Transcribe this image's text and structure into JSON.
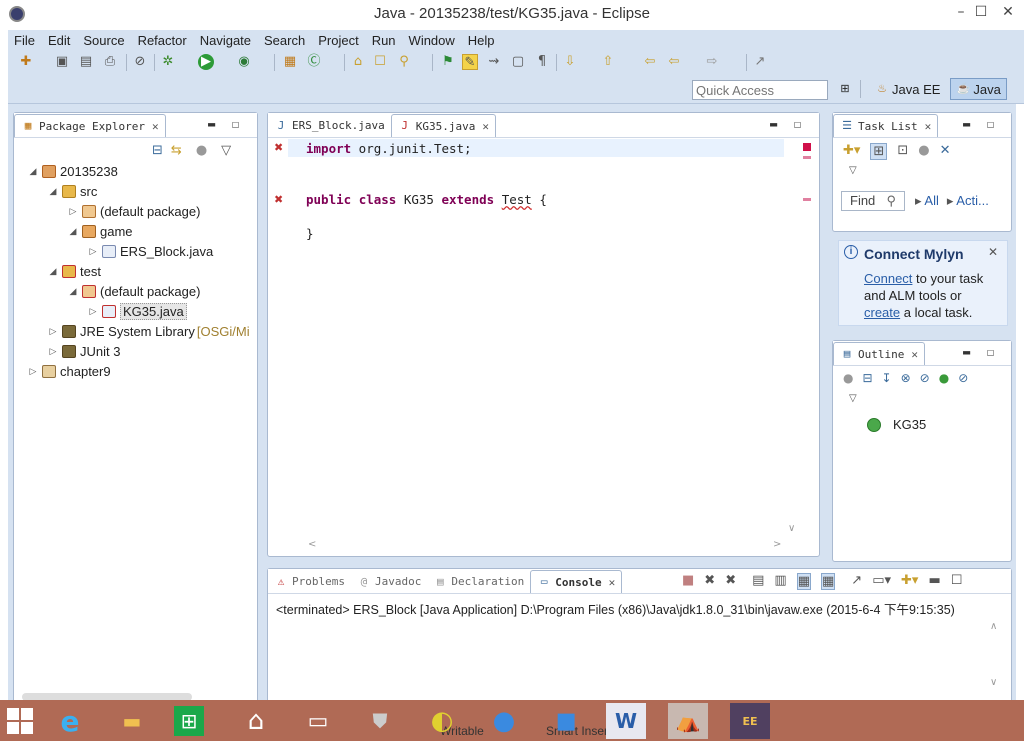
{
  "window": {
    "title": "Java - 20135238/test/KG35.java - Eclipse",
    "min": "–",
    "max": "☐",
    "close": "✕"
  },
  "menu": [
    "File",
    "Edit",
    "Source",
    "Refactor",
    "Navigate",
    "Search",
    "Project",
    "Run",
    "Window",
    "Help"
  ],
  "quick_access": {
    "placeholder": "Quick Access"
  },
  "perspectives": [
    {
      "label": "Java EE"
    },
    {
      "label": "Java",
      "active": true
    }
  ],
  "package_explorer": {
    "title": "Package Explorer",
    "items": [
      {
        "label": "20135238"
      },
      {
        "label": "src"
      },
      {
        "label": "(default package)"
      },
      {
        "label": "game"
      },
      {
        "label": "ERS_Block.java"
      },
      {
        "label": "test"
      },
      {
        "label": "(default package)"
      },
      {
        "label": "KG35.java"
      },
      {
        "label": "JRE System Library",
        "suffix": "[OSGi/Mi"
      },
      {
        "label": "JUnit 3"
      },
      {
        "label": "chapter9"
      }
    ]
  },
  "editor": {
    "tabs": [
      {
        "label": "ERS_Block.java"
      },
      {
        "label": "KG35.java",
        "active": true
      }
    ],
    "lines": {
      "l1_kw": "import",
      "l1_rest": " org.junit.Test;",
      "l3_kw1": "public",
      "l3_kw2": "class",
      "l3_name": " KG35 ",
      "l3_kw3": "extends",
      "l3_type": "Test",
      "l3_end": " {",
      "l5": "}"
    }
  },
  "task_list": {
    "title": "Task List",
    "find_placeholder": "Find",
    "all": "All",
    "activate": "Acti..."
  },
  "mylyn": {
    "title": "Connect Mylyn",
    "connect": "Connect",
    "text1": " to your task",
    "text2": "and ALM tools or",
    "create": "create",
    "text3": " a local task."
  },
  "outline": {
    "title": "Outline",
    "item": "KG35"
  },
  "bottom": {
    "tabs": [
      {
        "label": "Problems"
      },
      {
        "label": "Javadoc"
      },
      {
        "label": "Declaration"
      },
      {
        "label": "Console",
        "active": true
      }
    ],
    "console_text": "<terminated> ERS_Block [Java Application] D:\\Program Files (x86)\\Java\\jdk1.8.0_31\\bin\\javaw.exe (2015-6-4 下午9:15:35)"
  },
  "status": {
    "writable": "Writable",
    "insert": "Smart Insert"
  },
  "colors": {
    "frame": "#d6e2f1",
    "taskbar": "#b06a55",
    "keyword": "#7f0055"
  }
}
